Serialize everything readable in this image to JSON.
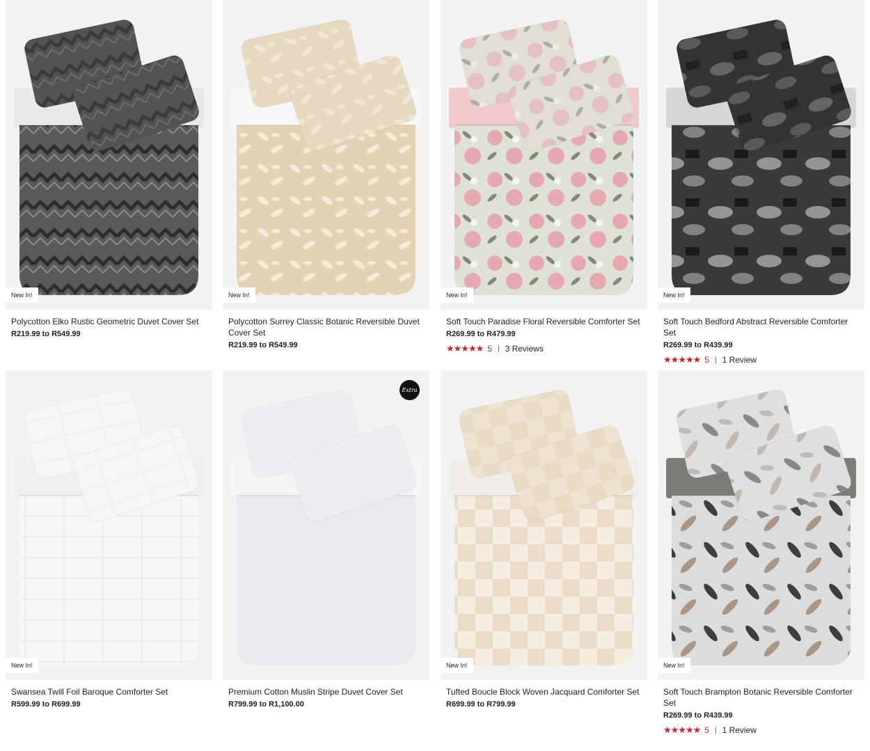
{
  "products": [
    {
      "badge": "New In!",
      "title": "Polycotton Elko Rustic Geometric Duvet Cover Set",
      "price": "R219.99 to R549.99",
      "rating": "",
      "reviews": "",
      "palette": {
        "bg": "#f2f2f2",
        "body": "#5a5a5c",
        "pattern": "#2e2e30",
        "accent": "#8c8c8e",
        "pillow": "#4a4a4c",
        "sheet": "#e8e8e6"
      }
    },
    {
      "badge": "New In!",
      "title": "Polycotton Surrey Classic Botanic Reversible Duvet Cover Set",
      "price": "R219.99 to R549.99",
      "rating": "",
      "reviews": "",
      "palette": {
        "bg": "#f2f2f2",
        "body": "#e3d2b4",
        "pattern": "#f3ead9",
        "accent": "#d8c4a2",
        "pillow": "#ece2cd",
        "sheet": "#f6f6f4"
      }
    },
    {
      "badge": "New In!",
      "title": "Soft Touch Paradise Floral Reversible Comforter Set",
      "price": "R269.99 to R479.99",
      "rating": "5",
      "reviews": "3 Reviews",
      "palette": {
        "bg": "#f2f2f2",
        "body": "#dfe1d7",
        "pattern": "#e6a9b0",
        "accent": "#7f8c6e",
        "pillow": "#e3ddd3",
        "sheet": "#f0c9cc"
      }
    },
    {
      "badge": "New In!",
      "title": "Soft Touch Bedford Abstract Reversible Comforter Set",
      "price": "R269.99 to R439.99",
      "rating": "5",
      "reviews": "1 Review",
      "palette": {
        "bg": "#f2f2f2",
        "body": "#3a3a3c",
        "pattern": "#bdbdbd",
        "accent": "#111113",
        "pillow": "#2a2a2c",
        "sheet": "#d6d6d6"
      }
    },
    {
      "badge": "New In!",
      "title": "Swansea Twill Foil Baroque Comforter Set",
      "price": "R599.99 to R699.99",
      "rating": "",
      "reviews": "",
      "palette": {
        "bg": "#f2f2f2",
        "body": "#f7f7f5",
        "pattern": "#e4e4e2",
        "accent": "#eeeeec",
        "pillow": "#f4f4f2",
        "sheet": "#efefed"
      }
    },
    {
      "badge": "",
      "title": "Premium Cotton Muslin Stripe Duvet Cover Set",
      "price": "R799.99 to R1,100.00",
      "rating": "",
      "reviews": "",
      "extra_logo": "Extra",
      "palette": {
        "bg": "#f2f2f2",
        "body": "#e9eaee",
        "pattern": "#e9eaee",
        "accent": "#e2e3e8",
        "pillow": "#f3f3f6",
        "sheet": "#f5f5f5"
      }
    },
    {
      "badge": "New In!",
      "title": "Tufted Boucle Block Woven Jacquard Comforter Set",
      "price": "R699.99 to R799.99",
      "rating": "",
      "reviews": "",
      "palette": {
        "bg": "#f2f2f2",
        "body": "#eadcc6",
        "pattern": "#f5ede0",
        "accent": "#e0cdb0",
        "pillow": "#e6d7bf",
        "sheet": "#f1eee9"
      }
    },
    {
      "badge": "New In!",
      "title": "Soft Touch Brampton Botanic Reversible Comforter Set",
      "price": "R269.99 to R439.99",
      "rating": "5",
      "reviews": "1 Review",
      "palette": {
        "bg": "#f2f2f2",
        "body": "#dcdcdc",
        "pattern": "#3e3f3d",
        "accent": "#a99686",
        "pillow": "#e2e2e0",
        "sheet": "#7b7e76"
      }
    }
  ],
  "icons": {
    "star": "star-icon"
  }
}
